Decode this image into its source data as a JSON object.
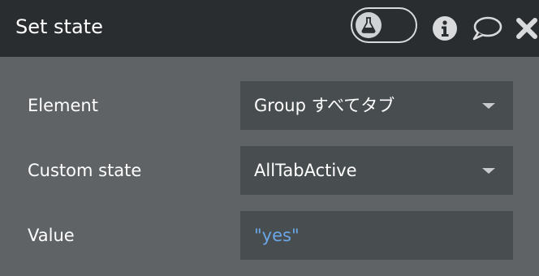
{
  "header": {
    "title": "Set state",
    "toggle_icon": "flask-icon",
    "info_icon": "info-icon",
    "comment_icon": "comment-icon",
    "close_icon": "close-icon"
  },
  "fields": [
    {
      "label": "Element",
      "value": "Group すべてタブ",
      "type": "dropdown"
    },
    {
      "label": "Custom state",
      "value": "AllTabActive",
      "type": "dropdown"
    },
    {
      "label": "Value",
      "value": "\"yes\"",
      "type": "input"
    }
  ],
  "colors": {
    "header_bg": "#292d30",
    "panel_bg": "#5f6366",
    "field_bg": "#484d50",
    "value_blue": "#6aa7e8"
  }
}
